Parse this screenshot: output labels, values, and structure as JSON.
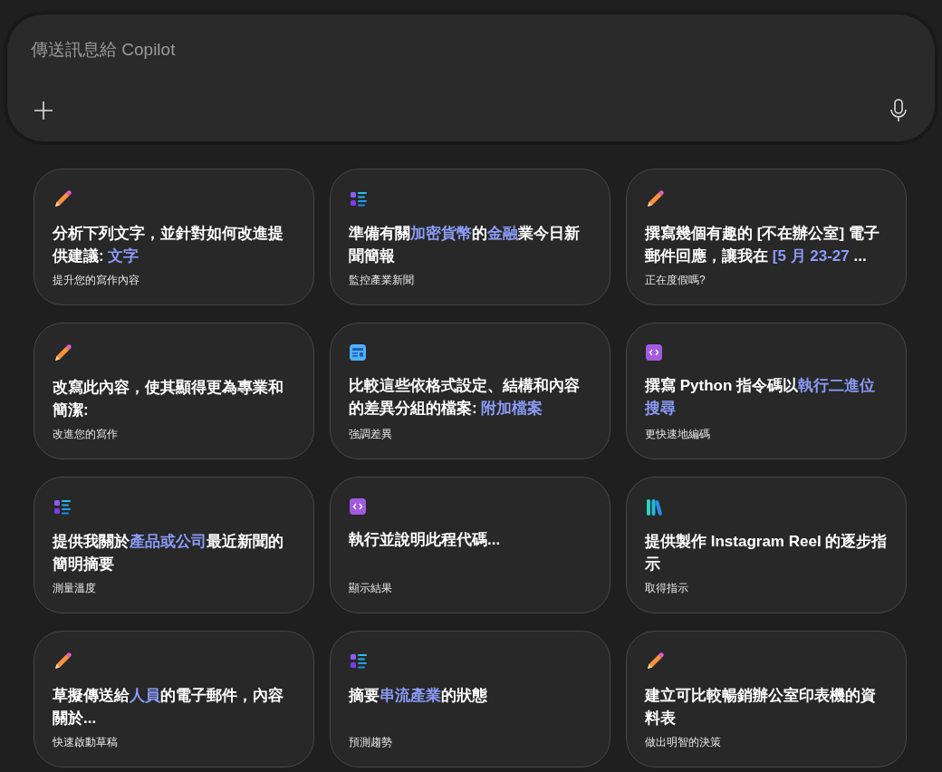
{
  "composer": {
    "placeholder": "傳送訊息給 Copilot"
  },
  "cards": [
    {
      "kind": "pencil",
      "title": [
        {
          "text": "分析下列文字，並針對如何改進提供建議: ",
          "highlight": false
        },
        {
          "text": "文字",
          "highlight": true
        }
      ],
      "subtitle": "提升您的寫作內容"
    },
    {
      "kind": "list",
      "title": [
        {
          "text": "準備有關",
          "highlight": false
        },
        {
          "text": "加密貨幣",
          "highlight": true
        },
        {
          "text": "的",
          "highlight": false
        },
        {
          "text": "金融",
          "highlight": true
        },
        {
          "text": "業今日新聞簡報",
          "highlight": false
        }
      ],
      "subtitle": "監控產業新聞"
    },
    {
      "kind": "pencil",
      "title": [
        {
          "text": "撰寫幾個有趣的 [不在辦公室] 電子郵件回應，讓我在 ",
          "highlight": false
        },
        {
          "text": "[5 月 23-27",
          "highlight": true
        },
        {
          "text": " ...",
          "highlight": false
        }
      ],
      "subtitle": "正在度假嗎?"
    },
    {
      "kind": "pencil",
      "title": [
        {
          "text": "改寫此內容，使其顯得更為專業和簡潔:",
          "highlight": false
        }
      ],
      "subtitle": "改進您的寫作"
    },
    {
      "kind": "layout",
      "title": [
        {
          "text": "比較這些依格式設定、結構和內容的差異分組的檔案: ",
          "highlight": false
        },
        {
          "text": "附加檔案",
          "highlight": true
        }
      ],
      "subtitle": "強調差異"
    },
    {
      "kind": "code",
      "title": [
        {
          "text": "撰寫 Python 指令碼以",
          "highlight": false
        },
        {
          "text": "執行二進位搜尋",
          "highlight": true
        }
      ],
      "subtitle": "更快速地編碼"
    },
    {
      "kind": "list",
      "title": [
        {
          "text": "提供我關於",
          "highlight": false
        },
        {
          "text": "產品或公司",
          "highlight": true
        },
        {
          "text": "最近新聞的簡明摘要",
          "highlight": false
        }
      ],
      "subtitle": "測量溫度"
    },
    {
      "kind": "code",
      "title": [
        {
          "text": "執行並說明此程代碼...",
          "highlight": false
        }
      ],
      "subtitle": "顯示結果"
    },
    {
      "kind": "books",
      "title": [
        {
          "text": "提供製作 Instagram Reel 的逐步指示",
          "highlight": false
        }
      ],
      "subtitle": "取得指示"
    },
    {
      "kind": "pencil",
      "title": [
        {
          "text": "草擬傳送給",
          "highlight": false
        },
        {
          "text": "人員",
          "highlight": true
        },
        {
          "text": "的電子郵件，內容關於...",
          "highlight": false
        }
      ],
      "subtitle": "快速啟動草稿"
    },
    {
      "kind": "list",
      "title": [
        {
          "text": "摘要",
          "highlight": false
        },
        {
          "text": "串流產業",
          "highlight": true
        },
        {
          "text": "的狀態",
          "highlight": false
        }
      ],
      "subtitle": "預測趨勢"
    },
    {
      "kind": "pencil",
      "title": [
        {
          "text": "建立可比較暢銷辦公室印表機的資料表",
          "highlight": false
        }
      ],
      "subtitle": "做出明智的決策"
    }
  ]
}
